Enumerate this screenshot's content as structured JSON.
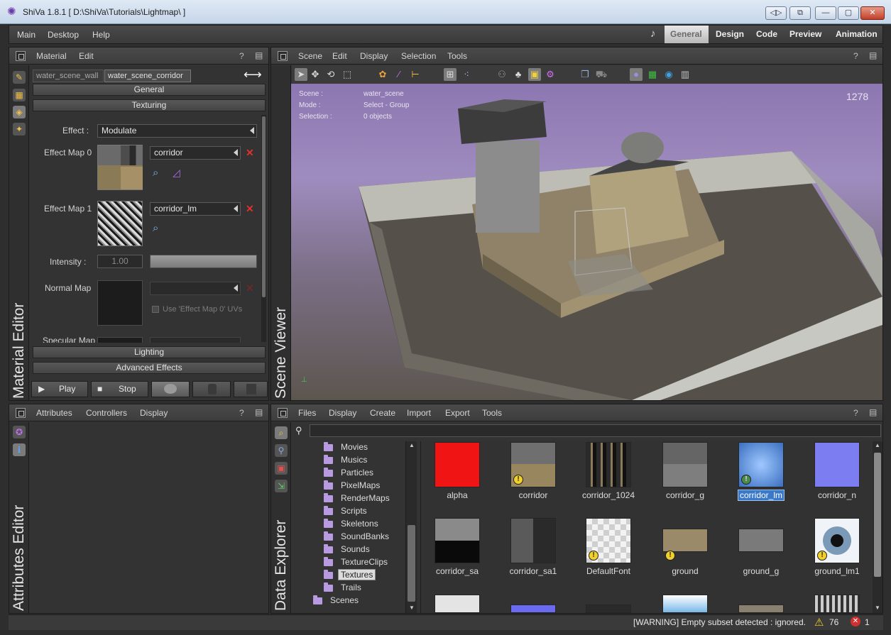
{
  "window": {
    "title": "ShiVa 1.8.1 [ D:\\ShiVa\\Tutorials\\Lightmap\\ ]",
    "controls": [
      "◁▷",
      "⧉",
      "—",
      "▢",
      "✕"
    ]
  },
  "menubar": {
    "items": [
      "Main",
      "Desktop",
      "Help"
    ],
    "modes": [
      "General",
      "Design",
      "Code",
      "Preview",
      "Animation"
    ],
    "active_mode": "General"
  },
  "material_editor": {
    "panel_title": "Material Editor",
    "menu": [
      "Material",
      "Edit"
    ],
    "tabs": [
      "water_scene_wall",
      "water_scene_corridor"
    ],
    "active_tab": "water_scene_corridor",
    "sections": {
      "general": "General",
      "texturing": "Texturing",
      "lighting": "Lighting",
      "advanced": "Advanced Effects"
    },
    "effect_label": "Effect :",
    "effect_value": "Modulate",
    "effect_map0_label": "Effect Map 0",
    "effect_map0_value": "corridor",
    "effect_map1_label": "Effect Map 1",
    "effect_map1_value": "corridor_lm",
    "intensity_label": "Intensity :",
    "intensity_value": "1.00",
    "normal_map_label": "Normal Map",
    "use_uvs_label": "Use 'Effect Map 0' UVs",
    "specular_label": "Specular Map",
    "play_label": "Play",
    "stop_label": "Stop"
  },
  "scene_viewer": {
    "panel_title": "Scene Viewer",
    "menu": [
      "Scene",
      "Edit",
      "Display",
      "Selection",
      "Tools"
    ],
    "info": {
      "scene_key": "Scene :",
      "scene_val": "water_scene",
      "mode_key": "Mode :",
      "mode_val": "Select - Group",
      "selection_key": "Selection :",
      "selection_val": "0 objects"
    },
    "fps": "1278"
  },
  "attributes_editor": {
    "panel_title": "Attributes Editor",
    "menu": [
      "Attributes",
      "Controllers",
      "Display"
    ]
  },
  "data_explorer": {
    "panel_title": "Data Explorer",
    "menu": [
      "Files",
      "Display",
      "Create",
      "Import",
      "Export",
      "Tools"
    ],
    "search_value": "",
    "tree": [
      "Movies",
      "Musics",
      "Particles",
      "PixelMaps",
      "RenderMaps",
      "Scripts",
      "Skeletons",
      "SoundBanks",
      "Sounds",
      "TextureClips",
      "Textures",
      "Trails",
      "Scenes"
    ],
    "selected_folder": "Textures",
    "textures_row1": [
      "alpha",
      "corridor",
      "corridor_1024",
      "corridor_g",
      "corridor_lm",
      "corridor_n"
    ],
    "textures_row2": [
      "corridor_sa",
      "corridor_sa1",
      "DefaultFont",
      "ground",
      "ground_g",
      "ground_lm1"
    ],
    "selected_texture": "corridor_lm"
  },
  "statusbar": {
    "message": "[WARNING] Empty subset detected : ignored.",
    "warning_count": "76",
    "error_count": "1"
  },
  "colors": {
    "viewport_bg": "#8d77b1",
    "selection": "#3a78c8",
    "folder": "#b79ae0",
    "error": "#e03030",
    "warning": "#f2d02a"
  }
}
